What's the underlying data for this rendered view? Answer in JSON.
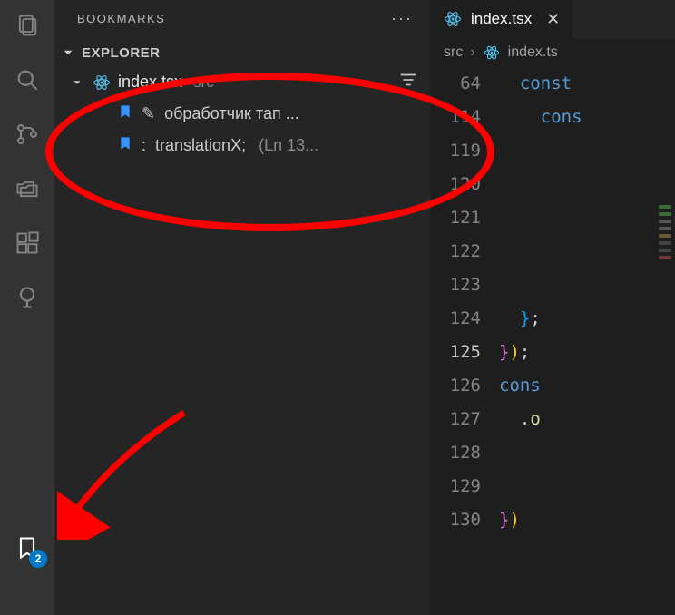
{
  "activity_bar": {
    "items": [
      "files",
      "search",
      "source-control",
      "folders",
      "extensions",
      "tree"
    ],
    "bookmark_badge": "2"
  },
  "sidebar": {
    "title": "BOOKMARKS",
    "section": "EXPLORER",
    "file": {
      "name": "index.tsx",
      "dir": "src"
    },
    "bookmarks": [
      {
        "decor": "✎",
        "text": "обработчик тап ...",
        "line": ""
      },
      {
        "decor": ":",
        "text": "translationX;",
        "line": "(Ln 13..."
      }
    ]
  },
  "editor": {
    "tab": {
      "name": "index.tsx"
    },
    "breadcrumb": {
      "folder": "src",
      "file": "index.ts"
    },
    "gutter": [
      "64",
      "114",
      "119",
      "120",
      "121",
      "122",
      "123",
      "124",
      "125",
      "126",
      "127",
      "128",
      "129",
      "130"
    ],
    "bookmark_line_index": 8,
    "code": [
      {
        "kind": "kw-indent1",
        "text": "const "
      },
      {
        "kind": "kw-indent2",
        "text": "cons"
      },
      {
        "kind": "blank",
        "text": ""
      },
      {
        "kind": "blank",
        "text": ""
      },
      {
        "kind": "blank",
        "text": ""
      },
      {
        "kind": "blank",
        "text": ""
      },
      {
        "kind": "blank",
        "text": ""
      },
      {
        "kind": "closebr",
        "text": "};"
      },
      {
        "kind": "callend",
        "text": "});"
      },
      {
        "kind": "kw",
        "text": "cons"
      },
      {
        "kind": "dot",
        "text": ".o"
      },
      {
        "kind": "blank",
        "text": ""
      },
      {
        "kind": "blank",
        "text": ""
      },
      {
        "kind": "close3",
        "text": "})"
      }
    ]
  },
  "colors": {
    "react": "#4ec4f0",
    "bookmark": "#3794ff",
    "badge": "#007acc",
    "annotation": "#ff0000"
  }
}
